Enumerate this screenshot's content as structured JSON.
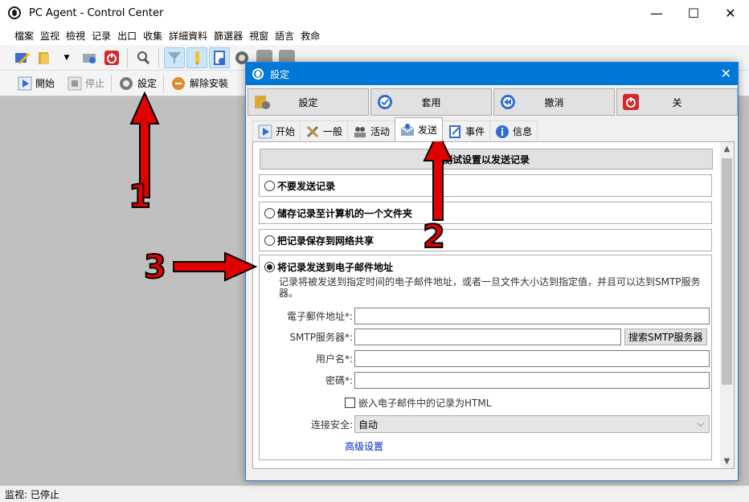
{
  "window": {
    "title": "PC Agent - Control Center",
    "controls": [
      "—",
      "☐",
      "✕"
    ]
  },
  "menu": [
    "檔案",
    "监视",
    "檢視",
    "记录",
    "出口",
    "收集",
    "詳細資料",
    "篩選器",
    "視窗",
    "語言",
    "救命"
  ],
  "toolbar2": {
    "start": "開始",
    "stop": "停止",
    "settings": "設定",
    "uninstall": "解除安裝"
  },
  "status": "监视: 已停止",
  "dialog": {
    "title": "設定",
    "close": "✕",
    "buttons": {
      "settings": "設定",
      "apply": "套用",
      "cancel": "撤消",
      "close": "关"
    },
    "tabs": [
      "开始",
      "一般",
      "活动",
      "发送",
      "事件",
      "信息"
    ],
    "section_header": "测试设置以发送记录",
    "options": {
      "no_send": "不要发送记录",
      "save_folder": "储存记录至计算机的一个文件夹",
      "save_share": "把记录保存到网络共享",
      "send_email": "将记录发送到电子邮件地址"
    },
    "email_desc": "记录将被发送到指定时间的电子邮件地址，或者一旦文件大小达到指定值，并且可以达到SMTP服务器。",
    "fields": {
      "email_label": "電子郵件地址*:",
      "email_value": "",
      "smtp_label": "SMTP服务器*:",
      "smtp_value": "",
      "smtp_button": "搜索SMTP服务器",
      "user_label": "用户名*:",
      "user_value": "",
      "password_label": "密碼*:",
      "password_value": "",
      "embed_html": "嵌入电子邮件中的记录为HTML",
      "security_label": "连接安全:",
      "security_value": "自动",
      "advanced": "高级设置"
    }
  },
  "annotations": {
    "n1": "1",
    "n2": "2",
    "n3": "3"
  },
  "colors": {
    "accent": "#0078d7",
    "annotation": "#e00000",
    "link": "#0026c8"
  }
}
